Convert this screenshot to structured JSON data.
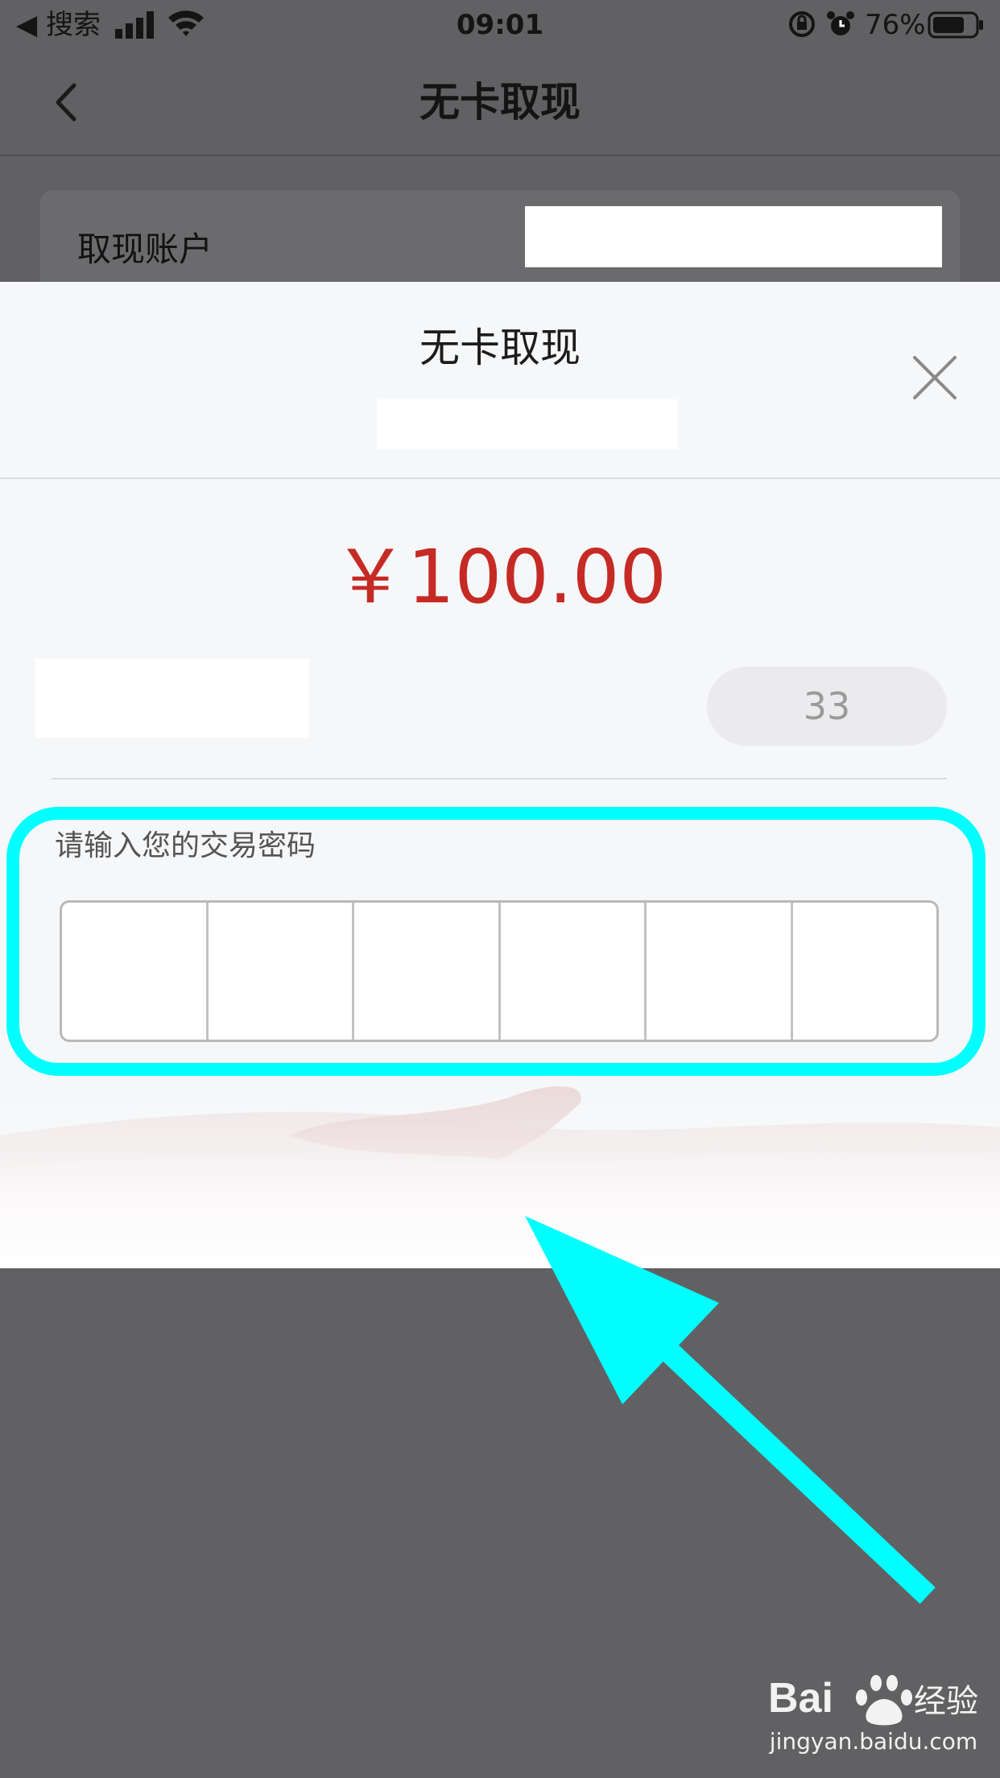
{
  "status_bar": {
    "back_app": "◀ 搜索",
    "time": "09:01",
    "battery_percent": "76%",
    "battery_level": 0.76
  },
  "nav": {
    "title": "无卡取现"
  },
  "form": {
    "account_label": "取现账户"
  },
  "sheet": {
    "title": "无卡取现",
    "amount": "￥100.00",
    "countdown": "33",
    "password_label": "请输入您的交易密码",
    "password_cells": 6
  },
  "colors": {
    "amount": "#c62a25",
    "highlight": "#00ffff",
    "overlay": "#616163"
  },
  "icons": [
    "back-chevron-icon",
    "close-icon",
    "signal-icon",
    "wifi-icon",
    "rotation-lock-icon",
    "alarm-icon",
    "battery-icon"
  ],
  "watermark": {
    "brand": "Bai",
    "suffix": "经验",
    "url": "jingyan.baidu.com"
  }
}
